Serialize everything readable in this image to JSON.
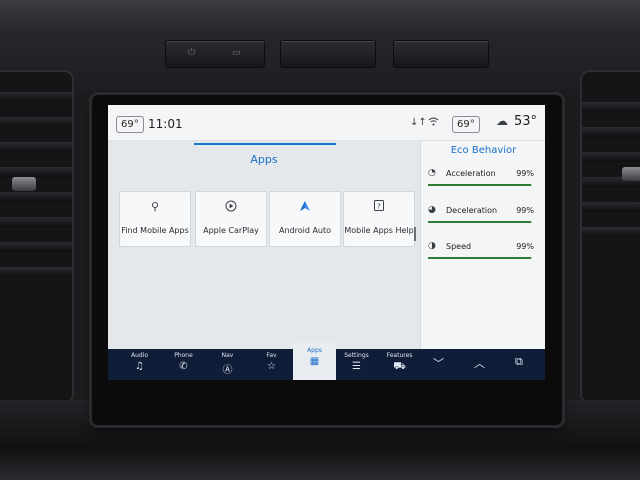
{
  "statusbar": {
    "inside_temp_left": "69°",
    "time": "11:01",
    "signal_glyph": "↓↑",
    "inside_temp_right": "69°",
    "outside_temp": "53°"
  },
  "apps": {
    "title": "Apps",
    "tiles": [
      {
        "label": "Find Mobile Apps",
        "icon": "search-apps-icon"
      },
      {
        "label": "Apple CarPlay",
        "icon": "carplay-icon"
      },
      {
        "label": "Android Auto",
        "icon": "android-auto-icon"
      },
      {
        "label": "Mobile Apps Help",
        "icon": "help-icon"
      }
    ]
  },
  "eco": {
    "title": "Eco Behavior",
    "rows": [
      {
        "name": "Acceleration",
        "value": "99%",
        "level": 0.99
      },
      {
        "name": "Deceleration",
        "value": "99%",
        "level": 0.99
      },
      {
        "name": "Speed",
        "value": "99%",
        "level": 0.99
      }
    ]
  },
  "nav": {
    "items": [
      {
        "label": "Audio",
        "icon": "music-note-icon"
      },
      {
        "label": "Phone",
        "icon": "phone-icon"
      },
      {
        "label": "Nav",
        "icon": "navigation-icon"
      },
      {
        "label": "Fav",
        "icon": "star-icon"
      },
      {
        "label": "Apps",
        "icon": "apps-grid-icon"
      },
      {
        "label": "Settings",
        "icon": "sliders-icon"
      },
      {
        "label": "Features",
        "icon": "car-icon"
      }
    ],
    "active": "Apps"
  },
  "colors": {
    "accent_blue": "#1a6fc7",
    "nav_background": "#101d38",
    "eco_good_green": "#2e7d32"
  }
}
